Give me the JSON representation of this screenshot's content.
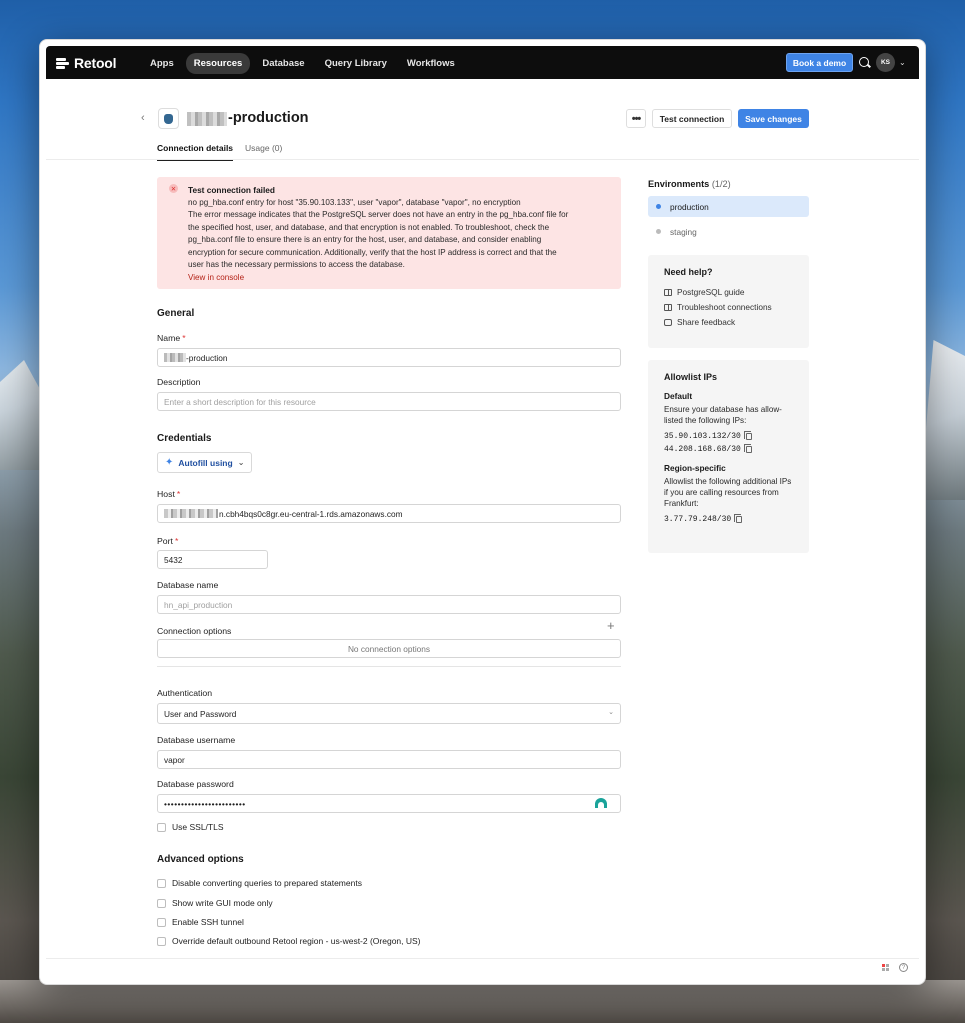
{
  "nav": {
    "brand": "Retool",
    "items": [
      {
        "label": "Apps",
        "active": false
      },
      {
        "label": "Resources",
        "active": true
      },
      {
        "label": "Database",
        "active": false
      },
      {
        "label": "Query Library",
        "active": false
      },
      {
        "label": "Workflows",
        "active": false
      }
    ],
    "book_demo": "Book a demo",
    "avatar_initials": "KS"
  },
  "header": {
    "title_suffix": "-production",
    "more_label": "•••",
    "test_connection": "Test connection",
    "save_changes": "Save changes",
    "tabs": [
      {
        "label": "Connection details",
        "active": true
      },
      {
        "label": "Usage (0)",
        "active": false
      }
    ]
  },
  "error": {
    "title": "Test connection failed",
    "lines": [
      "no pg_hba.conf entry for host \"35.90.103.133\", user \"vapor\", database \"vapor\", no encryption",
      "The error message indicates that the PostgreSQL server does not have an entry in the pg_hba.conf file for",
      "the specified host, user, and database, and that encryption is not enabled. To troubleshoot, check the",
      "pg_hba.conf file to ensure there is an entry for the host, user, and database, and consider enabling",
      "encryption for secure communication. Additionally, verify that the host IP address is correct and that the",
      "user has the necessary permissions to access the database."
    ],
    "link": "View in console"
  },
  "general": {
    "heading": "General",
    "name_label": "Name",
    "name_value_suffix": "-production",
    "description_label": "Description",
    "description_placeholder": "Enter a short description for this resource"
  },
  "credentials": {
    "heading": "Credentials",
    "autofill": "Autofill using",
    "host_label": "Host",
    "host_value_suffix": "n.cbh4bqs0c8gr.eu-central-1.rds.amazonaws.com",
    "port_label": "Port",
    "port_value": "5432",
    "dbname_label": "Database name",
    "dbname_placeholder": "hn_api_production",
    "conn_options_label": "Connection options",
    "conn_options_empty": "No connection options"
  },
  "auth": {
    "label": "Authentication",
    "value": "User and Password",
    "username_label": "Database username",
    "username_value": "vapor",
    "password_label": "Database password",
    "password_value": "••••••••••••••••••••••••",
    "ssl_label": "Use SSL/TLS"
  },
  "advanced": {
    "heading": "Advanced options",
    "options": [
      "Disable converting queries to prepared statements",
      "Show write GUI mode only",
      "Enable SSH tunnel",
      "Override default outbound Retool region - us-west-2 (Oregon, US)"
    ]
  },
  "environments": {
    "heading": "Environments",
    "count": "(1/2)",
    "items": [
      {
        "label": "production",
        "active": true
      },
      {
        "label": "staging",
        "active": false
      }
    ]
  },
  "help": {
    "heading": "Need help?",
    "links": [
      "PostgreSQL guide",
      "Troubleshoot connections",
      "Share feedback"
    ]
  },
  "allowlist": {
    "heading": "Allowlist IPs",
    "default_heading": "Default",
    "default_text": "Ensure your database has allow-listed the following IPs:",
    "default_ips": [
      "35.90.103.132/30",
      "44.208.168.68/30"
    ],
    "region_heading": "Region-specific",
    "region_text": "Allowlist the following additional IPs if you are calling resources from Frankfurt:",
    "region_ips": [
      "3.77.79.248/30"
    ]
  },
  "colors": {
    "accent": "#3f84e5",
    "error_bg": "#fde4e4",
    "nav_bg": "#0d0d0d"
  }
}
